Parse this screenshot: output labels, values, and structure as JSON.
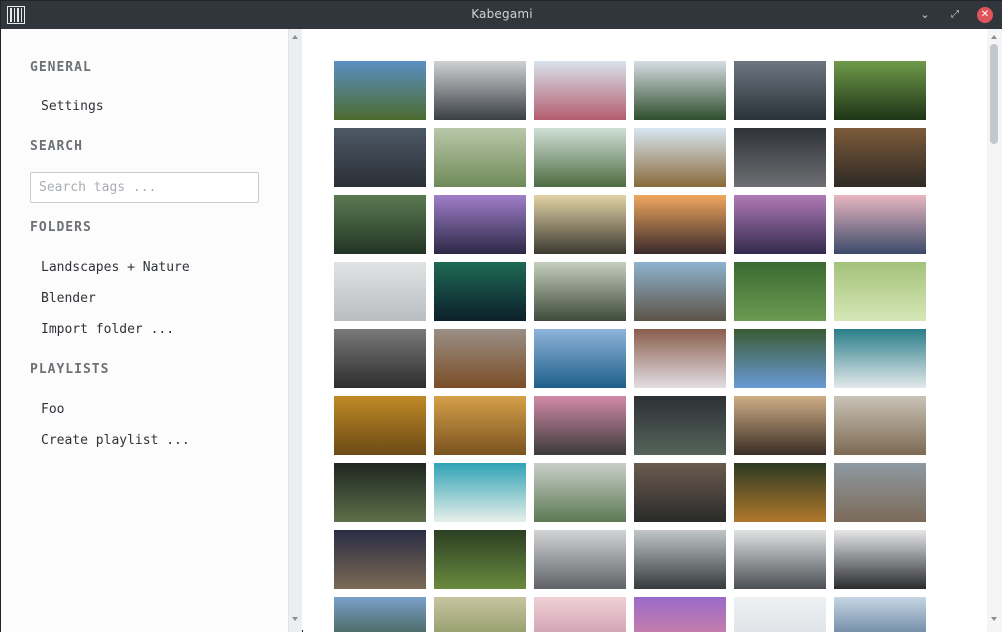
{
  "window": {
    "title": "Kabegami"
  },
  "sidebar": {
    "general": {
      "title": "GENERAL",
      "items": [
        "Settings"
      ]
    },
    "search": {
      "title": "SEARCH",
      "placeholder": "Search tags ..."
    },
    "folders": {
      "title": "FOLDERS",
      "items": [
        "Landscapes + Nature",
        "Blender",
        "Import folder ..."
      ]
    },
    "playlists": {
      "title": "PLAYLISTS",
      "items": [
        "Foo",
        "Create playlist ..."
      ]
    }
  },
  "gallery": {
    "columns": 6,
    "thumbnails": [
      {
        "top": "#5b8fc4",
        "bottom": "#4c6b2e"
      },
      {
        "top": "#cfd2d4",
        "bottom": "#3a3f44"
      },
      {
        "top": "#d8e3ec",
        "bottom": "#b35d70"
      },
      {
        "top": "#d6dde3",
        "bottom": "#2f4e2d"
      },
      {
        "top": "#6e7680",
        "bottom": "#2a3138"
      },
      {
        "top": "#6f9a4a",
        "bottom": "#1e3417"
      },
      {
        "top": "#4d5966",
        "bottom": "#2a2f36"
      },
      {
        "top": "#b9c8a8",
        "bottom": "#6f8a5a"
      },
      {
        "top": "#cfe0d6",
        "bottom": "#4f6b42"
      },
      {
        "top": "#d8e6f2",
        "bottom": "#8a6a3a"
      },
      {
        "top": "#2f3237",
        "bottom": "#6d6f73"
      },
      {
        "top": "#7c5a3a",
        "bottom": "#2e2a25"
      },
      {
        "top": "#5a7b52",
        "bottom": "#233424"
      },
      {
        "top": "#a07ec9",
        "bottom": "#2b2846"
      },
      {
        "top": "#e2d3a6",
        "bottom": "#3c3a30"
      },
      {
        "top": "#f0a75f",
        "bottom": "#3a2a2b"
      },
      {
        "top": "#b07ab6",
        "bottom": "#322a4d"
      },
      {
        "top": "#e8b7c2",
        "bottom": "#3b4a6a"
      },
      {
        "top": "#e1e3e4",
        "bottom": "#b9bdc0"
      },
      {
        "top": "#1d6a55",
        "bottom": "#0d1f2a"
      },
      {
        "top": "#c5cfbd",
        "bottom": "#3f4a3a"
      },
      {
        "top": "#8fb3cf",
        "bottom": "#5c5346"
      },
      {
        "top": "#3b6a32",
        "bottom": "#6c9a52"
      },
      {
        "top": "#a4c27a",
        "bottom": "#d6e7b7"
      },
      {
        "top": "#7a7a7a",
        "bottom": "#2d2d2d"
      },
      {
        "top": "#9a8f86",
        "bottom": "#7b4e26"
      },
      {
        "top": "#8fb4d9",
        "bottom": "#1e5f8a"
      },
      {
        "top": "#8a5e4c",
        "bottom": "#e3dde3"
      },
      {
        "top": "#3a5a33",
        "bottom": "#6a9ad6"
      },
      {
        "top": "#2a7e8a",
        "bottom": "#e3e9ea"
      },
      {
        "top": "#c08a26",
        "bottom": "#6b4a16"
      },
      {
        "top": "#d6a04a",
        "bottom": "#7a5320"
      },
      {
        "top": "#d28aa6",
        "bottom": "#3b3b3b"
      },
      {
        "top": "#2d3136",
        "bottom": "#55635a"
      },
      {
        "top": "#cfae86",
        "bottom": "#3a2e26"
      },
      {
        "top": "#c9c3b7",
        "bottom": "#7d6a52"
      },
      {
        "top": "#1e2620",
        "bottom": "#5e6f4a"
      },
      {
        "top": "#2fa3b6",
        "bottom": "#e8efe9"
      },
      {
        "top": "#c9cec9",
        "bottom": "#5b7a52"
      },
      {
        "top": "#6a5a4f",
        "bottom": "#2a2b2b"
      },
      {
        "top": "#2d3a22",
        "bottom": "#b0782c"
      },
      {
        "top": "#8e99a2",
        "bottom": "#7c6a58"
      },
      {
        "top": "#2a2d44",
        "bottom": "#7b6a55"
      },
      {
        "top": "#2b3f23",
        "bottom": "#6a8a3e"
      },
      {
        "top": "#d2d4d6",
        "bottom": "#5f6266"
      },
      {
        "top": "#c1c6c8",
        "bottom": "#353b3d"
      },
      {
        "top": "#e0e2e3",
        "bottom": "#4b4f53"
      },
      {
        "top": "#e6e7e8",
        "bottom": "#2a2b2c"
      },
      {
        "top": "#7aa0c8",
        "bottom": "#2f4a2b"
      },
      {
        "top": "#c8c4a0",
        "bottom": "#7a8a52"
      },
      {
        "top": "#f0d0d6",
        "bottom": "#c08aa0"
      },
      {
        "top": "#9a6ac8",
        "bottom": "#e08a9a"
      },
      {
        "top": "#eef0f2",
        "bottom": "#d8dde2"
      },
      {
        "top": "#c6d6e6",
        "bottom": "#3f5f7f"
      }
    ]
  }
}
